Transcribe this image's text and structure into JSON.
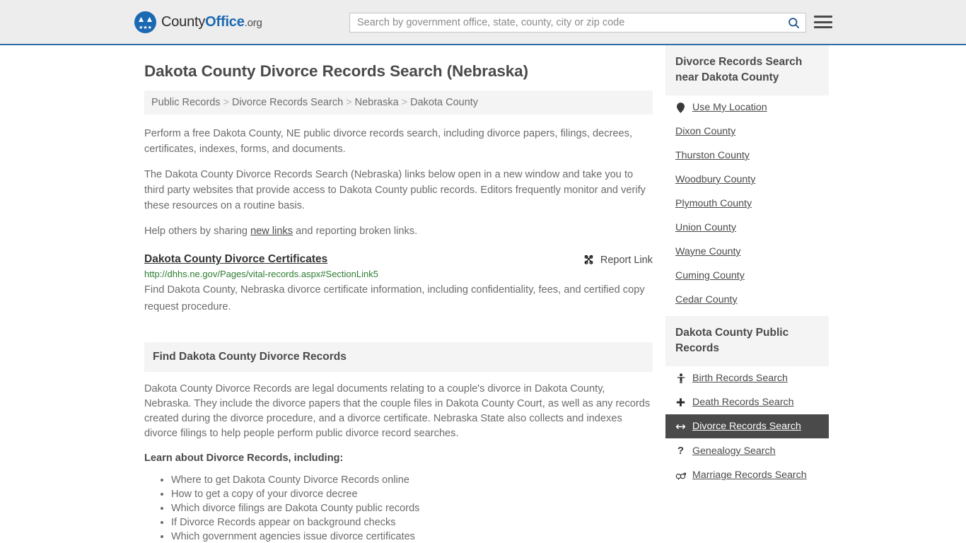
{
  "header": {
    "logo": {
      "name_part1": "County",
      "name_part2": "Office",
      "tld": ".org",
      "eagle_icon": "eagle-icon",
      "stars_icon": "three-stars-icon"
    },
    "search": {
      "placeholder": "Search by government office, state, county, city or zip code",
      "value": "",
      "search_icon": "search-icon"
    },
    "menu_icon": "hamburger-menu-icon"
  },
  "main": {
    "page_title": "Dakota County Divorce Records Search (Nebraska)",
    "breadcrumb": [
      "Public Records",
      "Divorce Records Search",
      "Nebraska",
      "Dakota County"
    ],
    "breadcrumb_separator": ">",
    "intro_paragraph": "Perform a free Dakota County, NE public divorce records search, including divorce papers, filings, decrees, certificates, indexes, forms, and documents.",
    "description_paragraph": "The Dakota County Divorce Records Search (Nebraska) links below open in a new window and take you to third party websites that provide access to Dakota County public records. Editors frequently monitor and verify these resources on a routine basis.",
    "share_prefix": "Help others by sharing ",
    "share_link": "new links",
    "share_suffix": " and reporting broken links.",
    "result": {
      "title": "Dakota County Divorce Certificates",
      "report_label": "Report Link",
      "report_icon": "broken-link-icon",
      "url": "http://dhhs.ne.gov/Pages/vital-records.aspx#SectionLink5",
      "description": "Find Dakota County, Nebraska divorce certificate information, including confidentiality, fees, and certified copy request procedure."
    },
    "panel": {
      "heading": "Find Dakota County Divorce Records",
      "paragraph": "Dakota County Divorce Records are legal documents relating to a couple's divorce in Dakota County, Nebraska. They include the divorce papers that the couple files in Dakota County Court, as well as any records created during the divorce procedure, and a divorce certificate. Nebraska State also collects and indexes divorce filings to help people perform public divorce record searches.",
      "subheading": "Learn about Divorce Records, including:",
      "bullets": [
        "Where to get Dakota County Divorce Records online",
        "How to get a copy of your divorce decree",
        "Which divorce filings are Dakota County public records",
        "If Divorce Records appear on background checks",
        "Which government agencies issue divorce certificates"
      ]
    }
  },
  "sidebar": {
    "nearby": {
      "heading": "Divorce Records Search near Dakota County",
      "items": [
        {
          "label": "Use My Location",
          "icon": "map-pin-icon",
          "active": false
        },
        {
          "label": "Dixon County",
          "icon": "",
          "active": false
        },
        {
          "label": "Thurston County",
          "icon": "",
          "active": false
        },
        {
          "label": "Woodbury County",
          "icon": "",
          "active": false
        },
        {
          "label": "Plymouth County",
          "icon": "",
          "active": false
        },
        {
          "label": "Union County",
          "icon": "",
          "active": false
        },
        {
          "label": "Wayne County",
          "icon": "",
          "active": false
        },
        {
          "label": "Cuming County",
          "icon": "",
          "active": false
        },
        {
          "label": "Cedar County",
          "icon": "",
          "active": false
        }
      ]
    },
    "public_records": {
      "heading": "Dakota County Public Records",
      "items": [
        {
          "label": "Birth Records Search",
          "icon": "child-icon",
          "glyph": "\u0001",
          "active": false
        },
        {
          "label": "Death Records Search",
          "icon": "cross-icon",
          "glyph": "✚",
          "active": false
        },
        {
          "label": "Divorce Records Search",
          "icon": "left-right-arrow-icon",
          "glyph": "↔",
          "active": true
        },
        {
          "label": "Genealogy Search",
          "icon": "question-mark-icon",
          "glyph": "?",
          "active": false
        },
        {
          "label": "Marriage Records Search",
          "icon": "male-female-icon",
          "glyph": "⚥",
          "active": false
        }
      ]
    }
  },
  "colors": {
    "brand_blue": "#1b69b2",
    "header_bg": "#ededed",
    "header_border": "#2f6ca8",
    "panel_bg": "#f4f4f4",
    "url_green": "#2e7d32",
    "active_bg": "#4a4a4a",
    "body_text": "#6b6b6b"
  }
}
